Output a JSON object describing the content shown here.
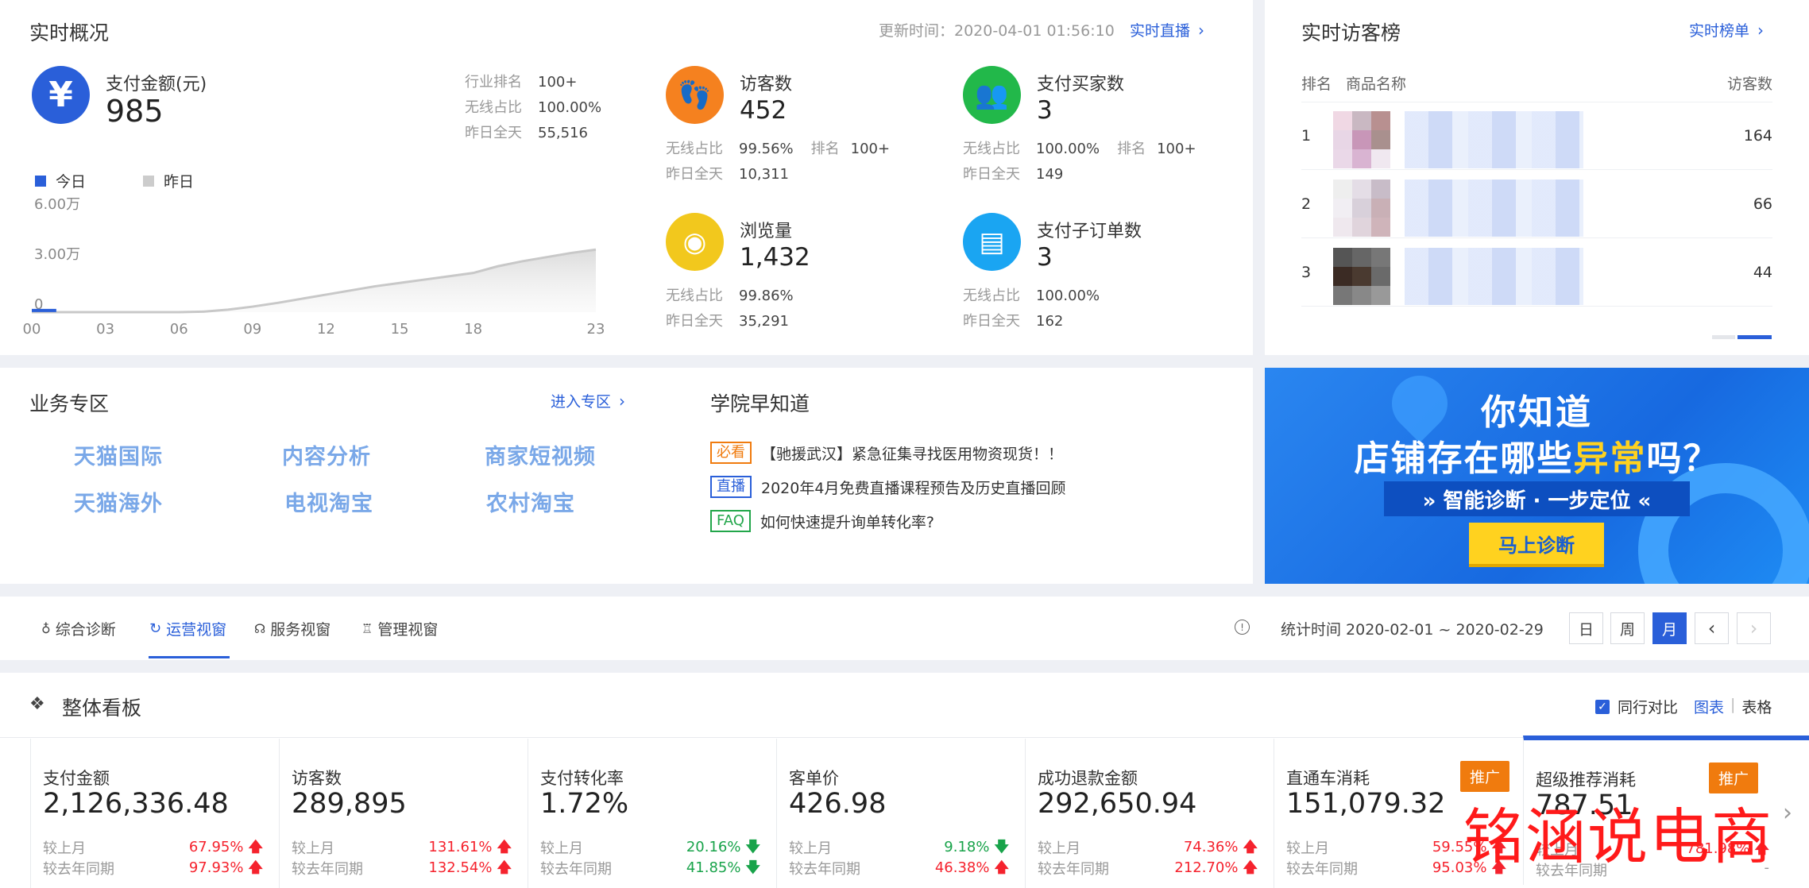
{
  "realtime": {
    "title": "实时概况",
    "update_label": "更新时间：2020-04-01 01:56:10",
    "live_link": "实时直播",
    "pay_amount": {
      "label": "支付金额(元)",
      "value": "985",
      "rows": [
        {
          "k": "行业排名",
          "v": "100+"
        },
        {
          "k": "无线占比",
          "v": "100.00%"
        },
        {
          "k": "昨日全天",
          "v": "55,516"
        }
      ]
    },
    "legend": {
      "today": "今日",
      "yesterday": "昨日"
    },
    "metrics": [
      {
        "label": "访客数",
        "value": "452",
        "line1_k": "无线占比",
        "line1_v": "99.56%",
        "rank_k": "排名",
        "rank_v": "100+",
        "line2_k": "昨日全天",
        "line2_v": "10,311",
        "icon": "footprint-icon",
        "color": "#f5811f"
      },
      {
        "label": "支付买家数",
        "value": "3",
        "line1_k": "无线占比",
        "line1_v": "100.00%",
        "rank_k": "排名",
        "rank_v": "100+",
        "line2_k": "昨日全天",
        "line2_v": "149",
        "icon": "users-icon",
        "color": "#22b84a"
      },
      {
        "label": "浏览量",
        "value": "1,432",
        "line1_k": "无线占比",
        "line1_v": "99.86%",
        "line2_k": "昨日全天",
        "line2_v": "35,291",
        "icon": "eye-icon",
        "color": "#f2c81d"
      },
      {
        "label": "支付子订单数",
        "value": "3",
        "line1_k": "无线占比",
        "line1_v": "100.00%",
        "line2_k": "昨日全天",
        "line2_v": "162",
        "icon": "clipboard-icon",
        "color": "#1aa5f2"
      }
    ]
  },
  "chart_data": {
    "type": "area",
    "title": "",
    "xlabel": "",
    "ylabel": "",
    "x_ticks": [
      "00",
      "03",
      "06",
      "09",
      "12",
      "15",
      "18",
      "23"
    ],
    "y_ticks": [
      "6.00万",
      "3.00万",
      "0"
    ],
    "ylim": [
      0,
      60000
    ],
    "x": [
      0,
      1,
      2,
      3,
      4,
      5,
      6,
      7,
      8,
      9,
      10,
      11,
      12,
      13,
      14,
      15,
      16,
      17,
      18,
      19,
      20,
      21,
      22,
      23
    ],
    "series": [
      {
        "name": "昨日",
        "color": "#c8c8c8",
        "values": [
          0,
          0,
          0,
          0,
          0,
          0,
          0,
          300,
          1500,
          3300,
          5500,
          8000,
          10500,
          13000,
          15500,
          17500,
          19500,
          21500,
          23500,
          27500,
          30500,
          33000,
          35500,
          37500
        ]
      },
      {
        "name": "今日",
        "color": "#2a5fd9",
        "values": [
          985,
          985
        ]
      }
    ],
    "legend": "top-left",
    "grid": false
  },
  "visitor_rank": {
    "title": "实时访客榜",
    "link": "实时榜单",
    "col_rank": "排名",
    "col_name": "商品名称",
    "col_visits": "访客数",
    "rows": [
      {
        "rank": "1",
        "visits": "164"
      },
      {
        "rank": "2",
        "visits": "66"
      },
      {
        "rank": "3",
        "visits": "44"
      }
    ]
  },
  "business": {
    "title": "业务专区",
    "link": "进入专区",
    "items": [
      "天猫国际",
      "内容分析",
      "商家短视频",
      "天猫海外",
      "电视淘宝",
      "农村淘宝"
    ]
  },
  "academy": {
    "title": "学院早知道",
    "news": [
      {
        "tag": "必看",
        "color": "#f07b0e",
        "text": "【驰援武汉】紧急征集寻找医用物资现货！！"
      },
      {
        "tag": "直播",
        "color": "#2a5fd9",
        "text": "2020年4月免费直播课程预告及历史直播回顾"
      },
      {
        "tag": "FAQ",
        "color": "#22a64a",
        "text": "如何快速提升询单转化率?"
      }
    ]
  },
  "banner": {
    "line1": "你知道",
    "line2a": "店铺存在哪些",
    "line2b": "异常",
    "line2c": "吗？",
    "line3": "» 智能诊断 · 一步定位 «",
    "button": "马上诊断"
  },
  "tabs": {
    "items": [
      "综合诊断",
      "运营视窗",
      "服务视窗",
      "管理视窗"
    ],
    "active": "运营视窗",
    "stat_time": "统计时间 2020-02-01 ~ 2020-02-29",
    "period_day": "日",
    "period_week": "周",
    "period_month": "月"
  },
  "dashboard": {
    "title": "整体看板",
    "peer_compare": "同行对比",
    "view_chart": "图表",
    "view_table": "表格",
    "cards": [
      {
        "label": "支付金额",
        "value": "2,126,336.48",
        "mom_k": "较上月",
        "mom_v": "67.95%",
        "mom_dir": "up",
        "yoy_k": "较去年同期",
        "yoy_v": "97.93%",
        "yoy_dir": "up"
      },
      {
        "label": "访客数",
        "value": "289,895",
        "mom_k": "较上月",
        "mom_v": "131.61%",
        "mom_dir": "up",
        "yoy_k": "较去年同期",
        "yoy_v": "132.54%",
        "yoy_dir": "up"
      },
      {
        "label": "支付转化率",
        "value": "1.72%",
        "mom_k": "较上月",
        "mom_v": "20.16%",
        "mom_dir": "down",
        "yoy_k": "较去年同期",
        "yoy_v": "41.85%",
        "yoy_dir": "down"
      },
      {
        "label": "客单价",
        "value": "426.98",
        "mom_k": "较上月",
        "mom_v": "9.18%",
        "mom_dir": "down",
        "yoy_k": "较去年同期",
        "yoy_v": "46.38%",
        "yoy_dir": "up"
      },
      {
        "label": "成功退款金额",
        "value": "292,650.94",
        "mom_k": "较上月",
        "mom_v": "74.36%",
        "mom_dir": "up",
        "yoy_k": "较去年同期",
        "yoy_v": "212.70%",
        "yoy_dir": "up"
      },
      {
        "label": "直通车消耗",
        "value": "151,079.32",
        "mom_k": "较上月",
        "mom_v": "59.55%",
        "mom_dir": "up",
        "yoy_k": "较去年同期",
        "yoy_v": "95.03%",
        "yoy_dir": "up",
        "promo": "推广"
      },
      {
        "label": "超级推荐消耗",
        "value": "787.51",
        "mom_k": "较上月",
        "mom_v": "781.98%",
        "mom_dir": "up",
        "yoy_k": "较去年同期",
        "yoy_v": "-",
        "yoy_dir": "",
        "promo": "推广"
      }
    ]
  },
  "watermark": "铭涵说电商",
  "colors": {
    "accent": "#2a5fd9",
    "up": "#f5222d",
    "down": "#18a34a",
    "promo": "#f07b0e"
  }
}
